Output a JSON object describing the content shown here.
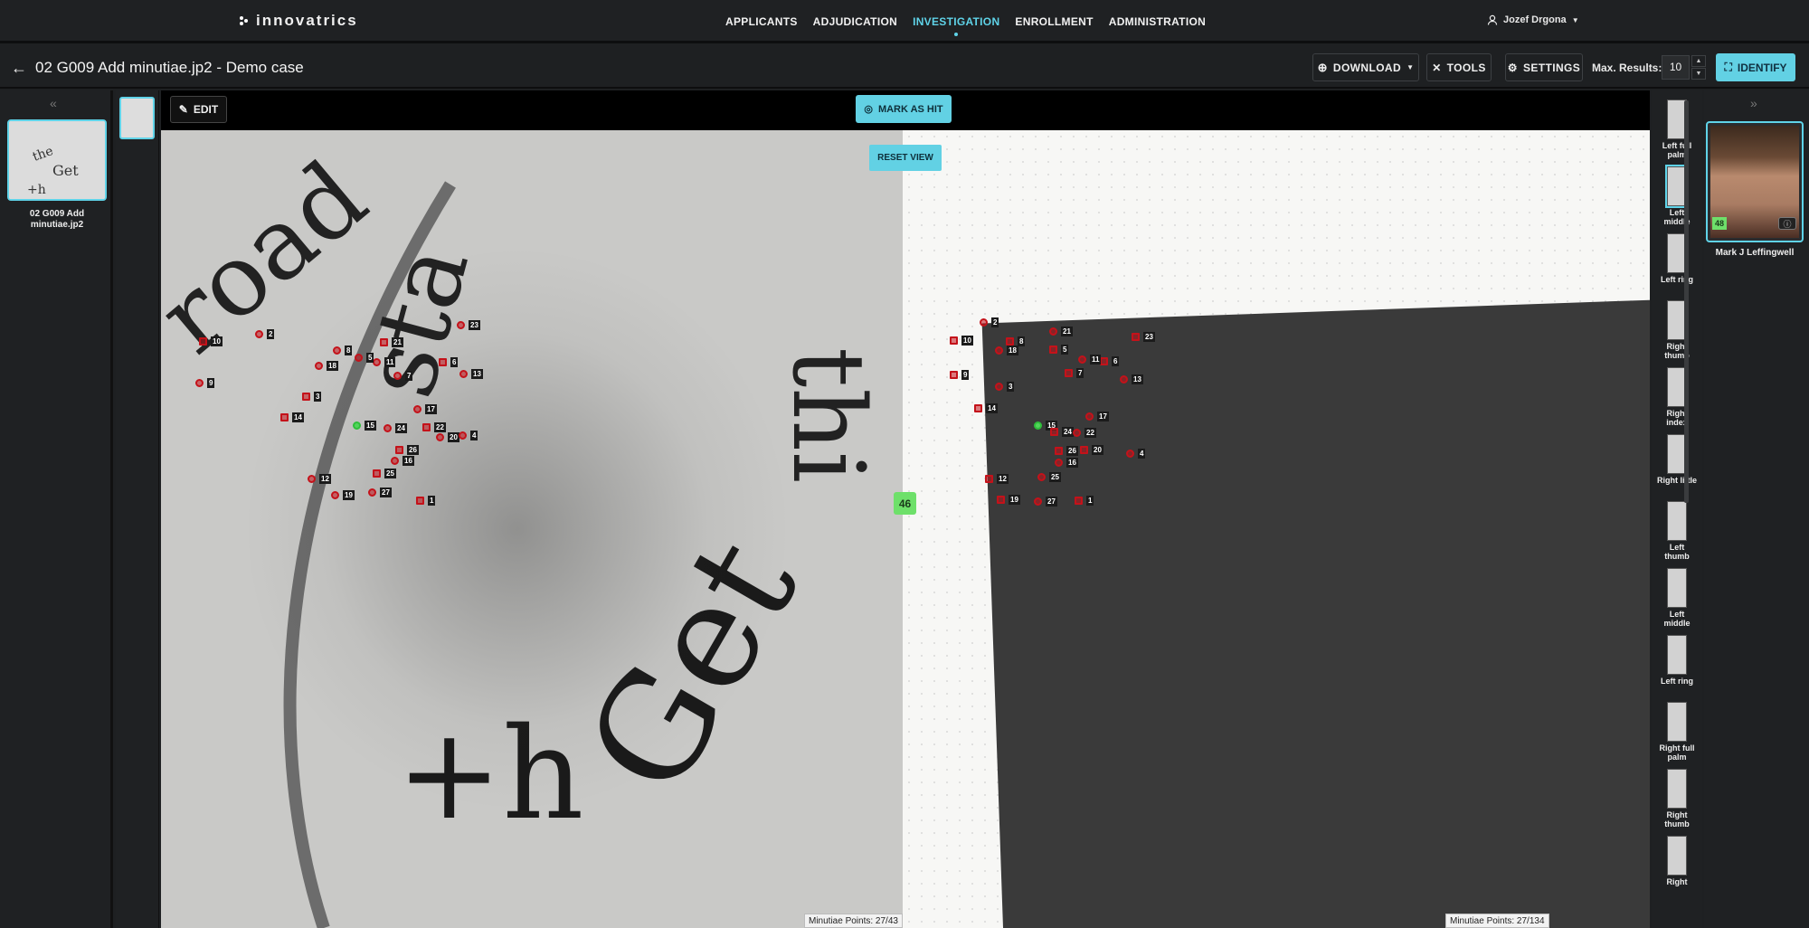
{
  "app": {
    "brand": "innovatrics",
    "accent": "#5fd3e8",
    "match_green": "#6ee06a",
    "minutia_red": "#c4121a"
  },
  "nav": {
    "items": [
      "APPLICANTS",
      "ADJUDICATION",
      "INVESTIGATION",
      "ENROLLMENT",
      "ADMINISTRATION"
    ],
    "active": "INVESTIGATION"
  },
  "user": {
    "name": "Jozef Drgona",
    "icon": "user-icon"
  },
  "toolbar": {
    "title": "02 G009 Add minutiae.jp2 - Demo case",
    "download": "DOWNLOAD",
    "tools": "TOOLS",
    "settings": "SETTINGS",
    "max_results_label": "Max. Results:",
    "max_results_value": "10",
    "identify": "IDENTIFY"
  },
  "case": {
    "thumb_label": "02 G009 Add minutiae.jp2"
  },
  "viewer": {
    "edit": "EDIT",
    "mark_as_hit": "MARK AS HIT",
    "reset_view": "RESET VIEW",
    "score": "46",
    "latent_minutiae": "Minutiae Points: 27/43",
    "reference_minutiae": "Minutiae Points: 27/134"
  },
  "fingers": [
    {
      "label": "Left full palm"
    },
    {
      "label": "Left middle",
      "selected": true
    },
    {
      "label": "Left ring"
    },
    {
      "label": "Right thumb"
    },
    {
      "label": "Right index"
    },
    {
      "label": "Right little"
    },
    {
      "label": "Left thumb"
    },
    {
      "label": "Left middle"
    },
    {
      "label": "Left ring"
    },
    {
      "label": "Right full palm"
    },
    {
      "label": "Right thumb"
    },
    {
      "label": "Right"
    }
  ],
  "candidate": {
    "name": "Mark J Leffingwell",
    "score": "48",
    "info_icon": "info-icon"
  },
  "minutiae": {
    "labels": [
      "10",
      "2",
      "8",
      "21",
      "23",
      "18",
      "6",
      "13",
      "9",
      "3",
      "7",
      "17",
      "14",
      "15",
      "24",
      "22",
      "20",
      "4",
      "26",
      "16",
      "12",
      "25",
      "19",
      "27",
      "1",
      "11",
      "5"
    ]
  }
}
